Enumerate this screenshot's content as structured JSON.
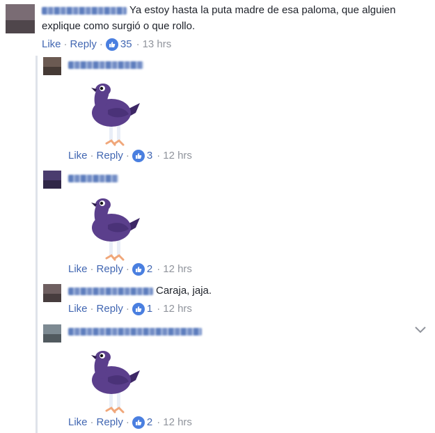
{
  "comments": [
    {
      "text": "Ya estoy hasta la puta madre de esa paloma, que alguien",
      "text2": "explique como surgió o que rollo.",
      "like": "Like",
      "reply": "Reply",
      "count": "35",
      "time": "13 hrs",
      "avatar_color": "#7a6c74"
    },
    {
      "like": "Like",
      "reply": "Reply",
      "count": "3",
      "time": "12 hrs",
      "avatar_color": "#6b5a52"
    },
    {
      "like": "Like",
      "reply": "Reply",
      "count": "2",
      "time": "12 hrs",
      "avatar_color": "#4a3c6e"
    },
    {
      "text": "Caraja, jaja.",
      "like": "Like",
      "reply": "Reply",
      "count": "1",
      "time": "12 hrs",
      "avatar_color": "#6e5f60"
    },
    {
      "like": "Like",
      "reply": "Reply",
      "count": "2",
      "time": "12 hrs",
      "avatar_color": "#7d8a92"
    }
  ],
  "separator": "·",
  "colors": {
    "link": "#4267b2",
    "meta": "#90949c",
    "like_badge": "#4a7fe0",
    "pigeon_body": "#5b3f8c",
    "pigeon_dark": "#3d2766",
    "thread_line": "#dfe3ea"
  },
  "icons": {
    "like_badge": "thumbs-up-icon",
    "sticker": "trash-dove-sticker",
    "menu": "chevron-down-icon"
  }
}
